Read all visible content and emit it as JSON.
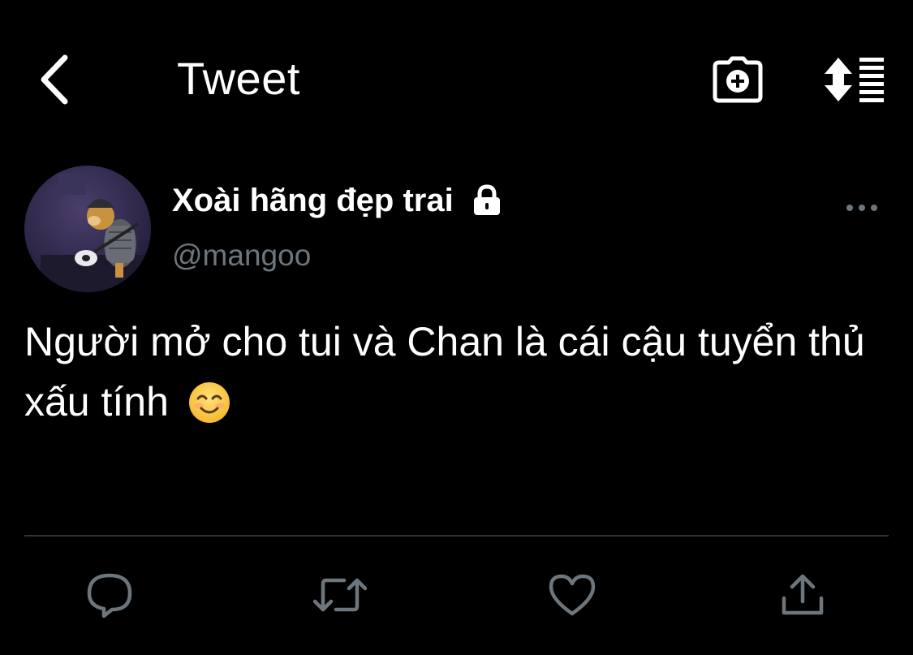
{
  "header": {
    "title": "Tweet",
    "icons": {
      "back": "chevron-left-icon",
      "camera": "camera-plus-icon",
      "sort": "sort-list-icon"
    }
  },
  "tweet": {
    "author": {
      "display_name": "Xoài hãng đẹp trai",
      "handle": "@mangoo",
      "protected_icon": "lock-icon"
    },
    "text": "Người mở cho tui và Chan là cái cậu tuyển thủ xấu tính",
    "emoji": "smiling-face-emoji",
    "more_icon": "more-horizontal-icon"
  },
  "actions": [
    {
      "name": "reply",
      "icon": "comment-icon"
    },
    {
      "name": "retweet",
      "icon": "retweet-icon"
    },
    {
      "name": "like",
      "icon": "heart-icon"
    },
    {
      "name": "share",
      "icon": "share-icon"
    }
  ],
  "colors": {
    "background": "#000000",
    "text": "#ffffff",
    "muted": "#6e767d",
    "divider": "#2f3336",
    "action_icon": "#6e767d"
  }
}
